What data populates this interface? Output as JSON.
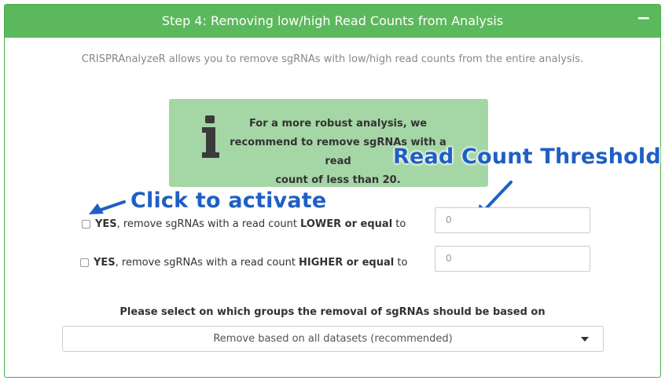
{
  "header": {
    "title": "Step 4: Removing low/high Read Counts from Analysis",
    "collapse_symbol": "−"
  },
  "intro_text": "CRISPRAnalyzeR allows you to remove sgRNAs with low/high read counts from the entire analysis.",
  "info_box": {
    "icon": "info-icon",
    "lines": [
      "For a more robust analysis, we",
      "recommend to remove sgRNAs with a read",
      "count of less than 20."
    ]
  },
  "annotations": {
    "threshold": "Read Count Threshold",
    "activate": "Click to activate"
  },
  "filters": {
    "lower": {
      "yes": "YES",
      "text_before": ", remove sgRNAs with a read count ",
      "emphasis": "LOWER or equal",
      "text_after": " to",
      "value": "0",
      "checked": false
    },
    "higher": {
      "yes": "YES",
      "text_before": ", remove sgRNAs with a read count ",
      "emphasis": "HIGHER or equal",
      "text_after": " to",
      "value": "0",
      "checked": false
    }
  },
  "group_select": {
    "label": "Please select on which groups the removal of sgRNAs should be based on",
    "selected": "Remove based on all datasets (recommended)"
  },
  "colors": {
    "header_bg": "#5cb85c",
    "info_bg": "#a5d6a5",
    "annotation": "#1f5fc4"
  }
}
